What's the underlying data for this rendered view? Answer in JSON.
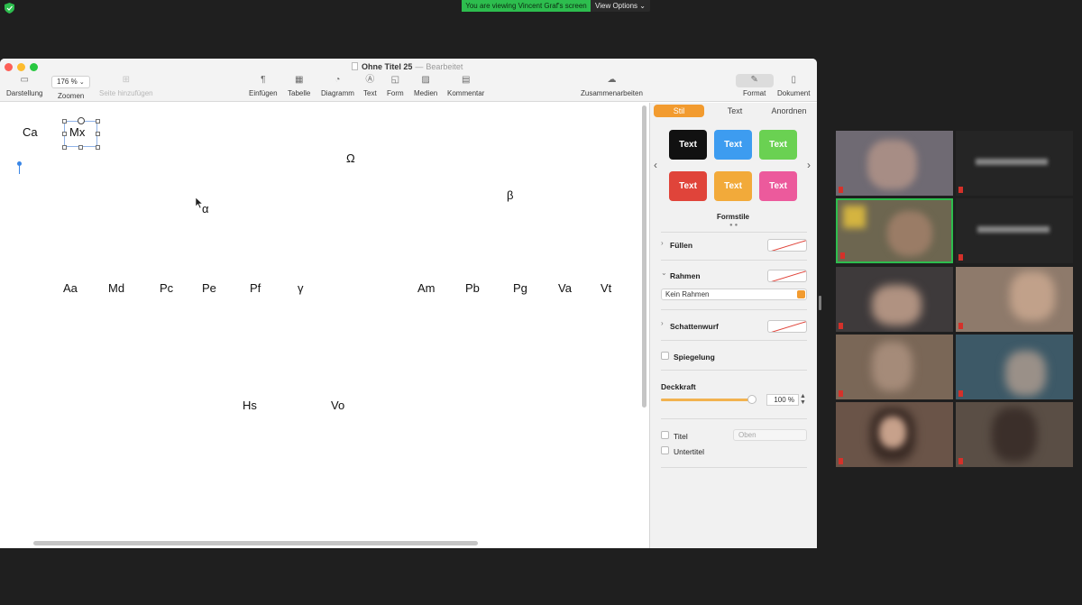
{
  "zoom_meeting": {
    "viewing_banner": "You are viewing Vincent Graf's screen",
    "view_options": "View Options",
    "colors": {
      "banner": "#2dbd4e",
      "background": "#1f1f1f"
    }
  },
  "pages_window": {
    "title": "Ohne Titel 25",
    "title_separator": "—",
    "status": "Bearbeitet",
    "toolbar": {
      "darstellung": "Darstellung",
      "zoom_value": "176 %",
      "zoom_label": "Zoomen",
      "add_page": "Seite hinzufügen",
      "insert": "Einfügen",
      "table": "Tabelle",
      "chart": "Diagramm",
      "text": "Text",
      "shape": "Form",
      "media": "Medien",
      "comment": "Kommentar",
      "collaborate": "Zusammenarbeiten",
      "format": "Format",
      "document": "Dokument"
    },
    "canvas_words": [
      "Ca",
      "Mx",
      "Ω",
      "β",
      "α",
      "Aa",
      "Md",
      "Pc",
      "Pe",
      "Pf",
      "γ",
      "Am",
      "Pb",
      "Pg",
      "Va",
      "Vt",
      "Hs",
      "Vo"
    ],
    "inspector": {
      "tabs": [
        "Stil",
        "Text",
        "Anordnen"
      ],
      "active_tab": "Stil",
      "style_buttons": [
        {
          "label": "Text",
          "color": "#111111"
        },
        {
          "label": "Text",
          "color": "#3d9cf0"
        },
        {
          "label": "Text",
          "color": "#6ad152"
        },
        {
          "label": "Text",
          "color": "#e0443a"
        },
        {
          "label": "Text",
          "color": "#f2aa3a"
        },
        {
          "label": "Text",
          "color": "#ec5a9c"
        }
      ],
      "styles_caption": "Formstile",
      "fill_label": "Füllen",
      "border_label": "Rahmen",
      "border_value": "Kein Rahmen",
      "shadow_label": "Schattenwurf",
      "reflection_label": "Spiegelung",
      "opacity_label": "Deckkraft",
      "opacity_value": "100 %",
      "opacity_level": 1.0,
      "title_label": "Titel",
      "title_position": "Oben",
      "subtitle_label": "Untertitel",
      "accent_color": "#f29b2f"
    }
  },
  "gallery": {
    "participants": [
      {
        "id": "p1",
        "bg": "#6f6a73"
      },
      {
        "id": "p2",
        "bg": "#252525"
      },
      {
        "id": "p3",
        "bg": "#6d6650"
      },
      {
        "id": "p4",
        "bg": "#252525"
      },
      {
        "id": "p5",
        "bg": "#3e3a3b"
      },
      {
        "id": "p6",
        "bg": "#8e7a6b"
      },
      {
        "id": "p7",
        "bg": "#7a6757"
      },
      {
        "id": "p8",
        "bg": "#3d5967"
      },
      {
        "id": "p9",
        "bg": "#6a5448"
      },
      {
        "id": "p10",
        "bg": "#5a4e45"
      }
    ]
  }
}
